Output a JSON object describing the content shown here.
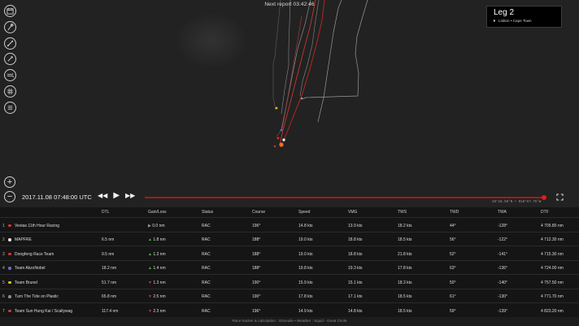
{
  "map": {
    "next_report": "Next report 03:42:46"
  },
  "tools": [
    {
      "name": "calendar-icon"
    },
    {
      "name": "marker-icon"
    },
    {
      "name": "route-icon"
    },
    {
      "name": "compass-icon"
    },
    {
      "name": "wind-icon"
    },
    {
      "name": "grid-icon"
    },
    {
      "name": "layers-icon"
    }
  ],
  "leg": {
    "title": "Leg 2",
    "route": "Lisbon • Cape Town"
  },
  "zoom": {
    "in": "+",
    "out": "−"
  },
  "playback": {
    "date": "2017.11.08 07:48:00 UTC",
    "rewind": "◀◀",
    "play": "▶",
    "forward": "▶▶",
    "progress": 1.0,
    "coords": "28°18.59'N • 018°57.75'W"
  },
  "table": {
    "headers": {
      "dtl": "DTL",
      "gain": "Gain/Loss",
      "status": "Status",
      "course": "Course",
      "speed": "Speed",
      "vmg": "VMG",
      "tws": "TWS",
      "twd": "TWD",
      "twa": "TWA",
      "dtf": "DTF"
    },
    "rows": [
      {
        "rank": "1",
        "color": "#e03030",
        "team": "Vestas 11th Hour Racing",
        "dtl": "",
        "gain_dir": "right",
        "gain": "0.0 nm",
        "status": "RAC",
        "course": "196°",
        "speed": "14.8 kts",
        "vmg": "13.9 kts",
        "tws": "18.2 kts",
        "twd": "44°",
        "twa": "-128°",
        "dtf": "4 705.80 nm"
      },
      {
        "rank": "2",
        "color": "#e8e8e8",
        "team": "MAPFRE",
        "dtl": "6.5 nm",
        "gain_dir": "up",
        "gain": "1.8 nm",
        "status": "RAC",
        "course": "188°",
        "speed": "19.0 kts",
        "vmg": "18.8 kts",
        "tws": "18.5 kts",
        "twd": "56°",
        "twa": "-122°",
        "dtf": "4 712.30 nm"
      },
      {
        "rank": "3",
        "color": "#e03030",
        "team": "Dongfeng Race Team",
        "dtl": "9.5 nm",
        "gain_dir": "up",
        "gain": "1.3 nm",
        "status": "RAC",
        "course": "188°",
        "speed": "19.0 kts",
        "vmg": "18.8 kts",
        "tws": "21.8 kts",
        "twd": "52°",
        "twa": "-141°",
        "dtf": "4 715.30 nm"
      },
      {
        "rank": "4",
        "color": "#6a6ae0",
        "team": "Team AkzoNobel",
        "dtl": "18.2 nm",
        "gain_dir": "up",
        "gain": "1.4 nm",
        "status": "RAC",
        "course": "188°",
        "speed": "19.8 kts",
        "vmg": "19.3 kts",
        "tws": "17.8 kts",
        "twd": "63°",
        "twa": "-136°",
        "dtf": "4 724.00 nm"
      },
      {
        "rank": "5",
        "color": "#e6c020",
        "team": "Team Brunel",
        "dtl": "51.7 nm",
        "gain_dir": "down",
        "gain": "1.3 nm",
        "status": "RAC",
        "course": "190°",
        "speed": "15.9 kts",
        "vmg": "15.1 kts",
        "tws": "18.3 kts",
        "twd": "50°",
        "twa": "-140°",
        "dtf": "4 757.50 nm"
      },
      {
        "rank": "6",
        "color": "#8a8a8a",
        "team": "Turn The Tide on Plastic",
        "dtl": "65.8 nm",
        "gain_dir": "down",
        "gain": "2.5 nm",
        "status": "RAC",
        "course": "190°",
        "speed": "17.8 kts",
        "vmg": "17.1 kts",
        "tws": "18.5 kts",
        "twd": "61°",
        "twa": "-130°",
        "dtf": "4 771.70 nm"
      },
      {
        "rank": "7",
        "color": "#c04040",
        "team": "Team Sun Hung Kai / Scallywag",
        "dtl": "117.4 nm",
        "gain_dir": "down",
        "gain": "2.3 nm",
        "status": "RAC",
        "course": "196°",
        "speed": "14.9 kts",
        "vmg": "14.8 kts",
        "tws": "18.5 kts",
        "twd": "59°",
        "twa": "-139°",
        "dtf": "4 823.20 nm"
      }
    ]
  },
  "footer": "Race tracker & calculation : Géovoile • Weather : Squid - Great Circle",
  "colors": {
    "accent": "#e01b1b",
    "gain_up": "#3fbf3f",
    "gain_down": "#e03030"
  }
}
